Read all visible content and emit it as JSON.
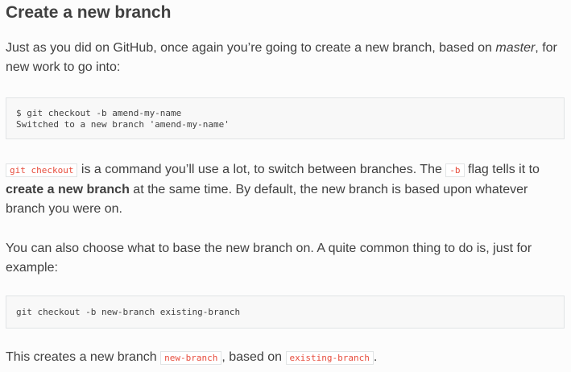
{
  "heading": "Create a new branch",
  "para1": {
    "before": "Just as you did on GitHub, once again you’re going to create a new branch, based on ",
    "em": "master",
    "after": ", for new work to go into:"
  },
  "code1": {
    "line1": "$ git checkout -b amend-my-name",
    "line2": "Switched to a new branch 'amend-my-name'"
  },
  "para2": {
    "code_a": "git checkout",
    "text_a": " is a command you’ll use a lot, to switch between branches. The ",
    "code_b": "-b",
    "text_b": " flag tells it to ",
    "strong": "create a new branch",
    "text_c": " at the same time. By default, the new branch is based upon whatever branch you were on."
  },
  "para3": "You can also choose what to base the new branch on. A quite common thing to do is, just for example:",
  "code2": "git checkout -b new-branch existing-branch",
  "para4": {
    "text_a": "This creates a new branch ",
    "code_a": "new-branch",
    "text_b": ", based on ",
    "code_b": "existing-branch",
    "text_c": "."
  }
}
